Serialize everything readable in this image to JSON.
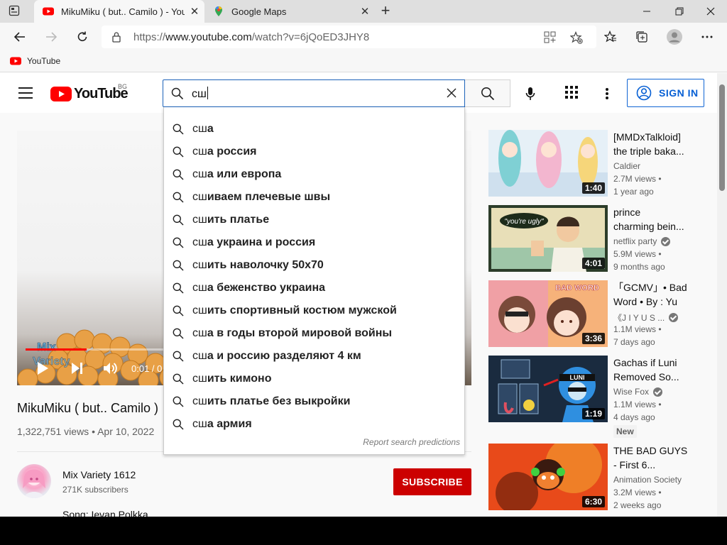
{
  "browser": {
    "tabs": [
      {
        "title": "MikuMiku ( but.. Camilo ) - YouT",
        "active": true
      },
      {
        "title": "Google Maps",
        "active": false
      }
    ],
    "url_prefix": "https://",
    "url_host": "www.youtube.com",
    "url_path": "/watch?v=6jQoED3JHY8",
    "bookmarks": [
      {
        "label": "YouTube"
      }
    ]
  },
  "youtube": {
    "region": "BG",
    "logo_text": "YouTube",
    "search": {
      "query": "сш"
    },
    "signin_label": "SIGN IN",
    "suggestions": [
      {
        "prefix": "сш",
        "rest": "а"
      },
      {
        "prefix": "сш",
        "rest": "а россия"
      },
      {
        "prefix": "сш",
        "rest": "а или европа"
      },
      {
        "prefix": "сш",
        "rest": "иваем плечевые швы"
      },
      {
        "prefix": "сш",
        "rest": "ить платье"
      },
      {
        "prefix": "сш",
        "rest": "а украина и россия"
      },
      {
        "prefix": "сш",
        "rest": "ить наволочку 50х70"
      },
      {
        "prefix": "сш",
        "rest": "а беженство украина"
      },
      {
        "prefix": "сш",
        "rest": "ить спортивный костюм мужской"
      },
      {
        "prefix": "сш",
        "rest": "а в годы второй мировой войны"
      },
      {
        "prefix": "сш",
        "rest": "а и россию разделяют 4 км"
      },
      {
        "prefix": "сш",
        "rest": "ить кимоно"
      },
      {
        "prefix": "сш",
        "rest": "ить платье без выкройки"
      },
      {
        "prefix": "сш",
        "rest": "а армия"
      }
    ],
    "report_label": "Report search predictions",
    "video": {
      "title": "MikuMiku ( but.. Camilo )",
      "meta": "1,322,751 views • Apr 10, 2022",
      "time": "0:01 / 0",
      "progress_fraction": 0.14
    },
    "channel": {
      "name": "Mix Variety 1612",
      "subscribers": "271K subscribers",
      "subscribe_label": "SUBSCRIBE",
      "description": "Song: Ievan Polkka"
    },
    "recommendations": [
      {
        "title1": "[MMDxTalkloid]",
        "title2": "the triple baka...",
        "channel": "Caldier",
        "verified": false,
        "views": "2.7M views •",
        "age": "1 year ago",
        "duration": "1:40",
        "colors": [
          "#e6f0f7",
          "#7fd0d4",
          "#f3b6cf"
        ]
      },
      {
        "title1": "prince",
        "title2": "charming bein...",
        "channel": "netflix party",
        "verified": true,
        "views": "5.9M views •",
        "age": "9 months ago",
        "duration": "4:01",
        "colors": [
          "#e8dfb8",
          "#9fc6a8",
          "#3c2a1f"
        ]
      },
      {
        "title1": "「GCMV」• Bad",
        "title2": "Word • By : Yu",
        "channel": "《J I Y U S ...",
        "verified": true,
        "views": "1.1M views •",
        "age": "7 days ago",
        "duration": "3:36",
        "colors": [
          "#f0a0a5",
          "#6b4030",
          "#f6d0a0"
        ]
      },
      {
        "title1": "Gachas if Luni",
        "title2": "Removed So...",
        "channel": "Wise Fox",
        "verified": true,
        "views": "1.1M views •",
        "age": "4 days ago",
        "duration": "1:19",
        "colors": [
          "#1a2b3f",
          "#2f8fe0",
          "#d0e8f5"
        ]
      },
      {
        "title1": "THE BAD GUYS",
        "title2": "- First 6...",
        "channel": "Animation Society",
        "verified": false,
        "views": "3.2M views •",
        "age": "2 weeks ago",
        "duration": "6:30",
        "colors": [
          "#e84a1a",
          "#f4a330",
          "#5a1a0a"
        ]
      }
    ],
    "new_badge": "New"
  }
}
